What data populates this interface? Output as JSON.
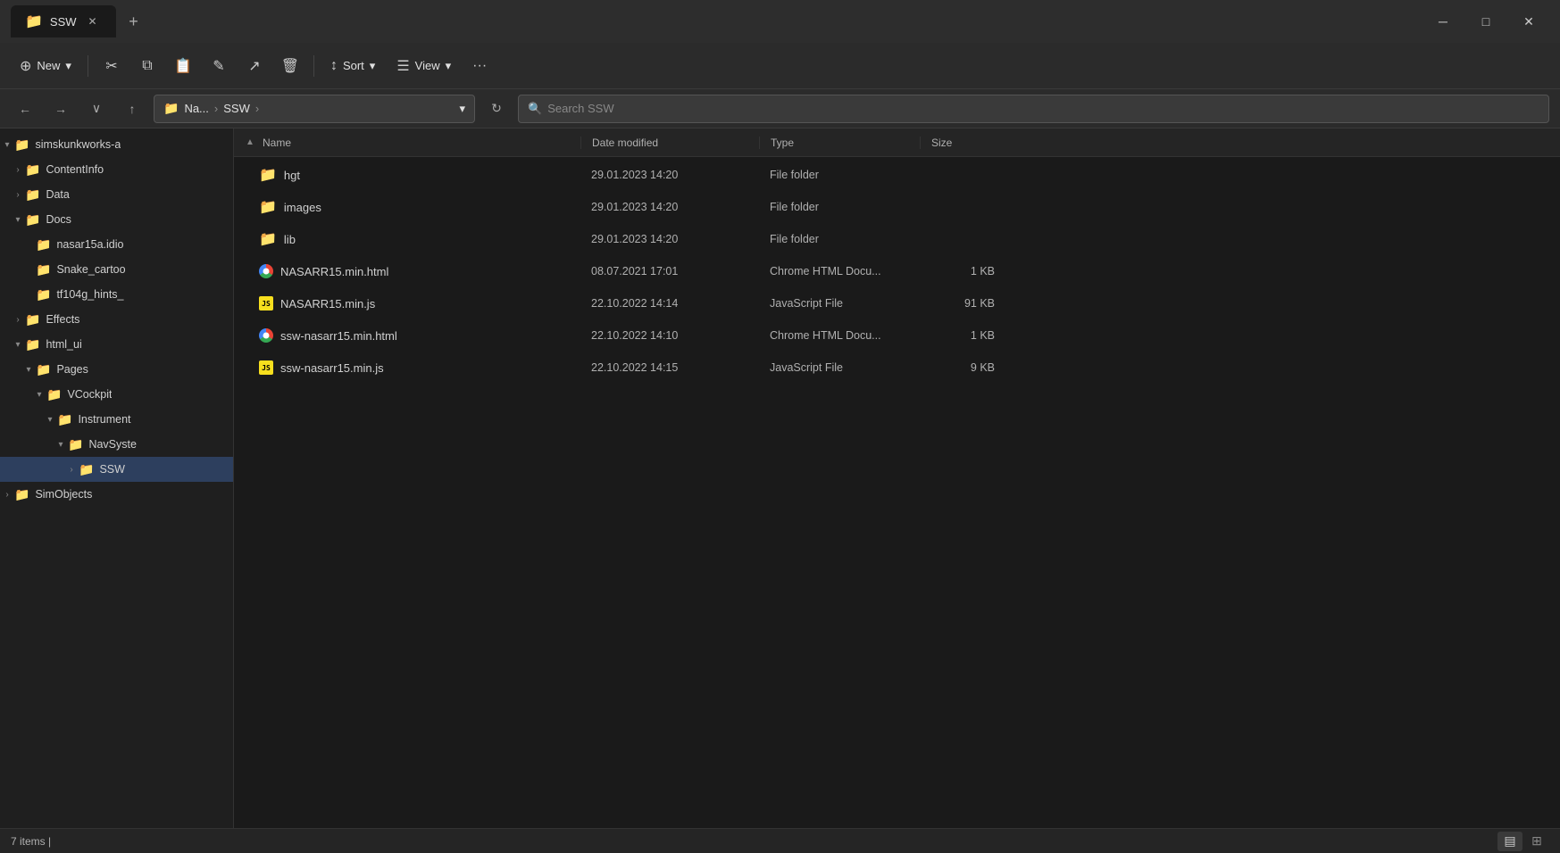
{
  "window": {
    "title": "SSW",
    "tab_label": "SSW",
    "new_tab_tooltip": "New tab"
  },
  "toolbar": {
    "new_label": "New",
    "new_arrow": "▾",
    "cut_icon": "✂",
    "copy_icon": "⧉",
    "paste_icon": "📋",
    "rename_icon": "✎",
    "share_icon": "↗",
    "delete_icon": "🗑",
    "sort_label": "Sort",
    "sort_icon": "↑↓",
    "sort_arrow": "▾",
    "view_label": "View",
    "view_icon": "☰",
    "view_arrow": "▾",
    "more_icon": "···"
  },
  "address": {
    "back_arrow": "←",
    "forward_arrow": "→",
    "recent_arrow": "∨",
    "up_arrow": "↑",
    "path_parts": [
      "Na...",
      "SSW"
    ],
    "search_placeholder": "Search SSW",
    "refresh_icon": "↻"
  },
  "sidebar": {
    "items": [
      {
        "id": "simskunkworks",
        "label": "simskunkworks-a",
        "indent": 0,
        "expanded": true,
        "selected": false
      },
      {
        "id": "contentinfo",
        "label": "ContentInfo",
        "indent": 1,
        "expanded": false,
        "selected": false
      },
      {
        "id": "data",
        "label": "Data",
        "indent": 1,
        "expanded": false,
        "selected": false
      },
      {
        "id": "docs",
        "label": "Docs",
        "indent": 1,
        "expanded": true,
        "selected": false
      },
      {
        "id": "nasar15a",
        "label": "nasar15a.idio",
        "indent": 2,
        "expanded": false,
        "selected": false,
        "noChevron": true
      },
      {
        "id": "snake_cartoon",
        "label": "Snake_cartoo",
        "indent": 2,
        "expanded": false,
        "selected": false,
        "noChevron": true
      },
      {
        "id": "tf104g",
        "label": "tf104g_hints_",
        "indent": 2,
        "expanded": false,
        "selected": false,
        "noChevron": true
      },
      {
        "id": "effects",
        "label": "Effects",
        "indent": 1,
        "expanded": false,
        "selected": false
      },
      {
        "id": "html_ui",
        "label": "html_ui",
        "indent": 1,
        "expanded": true,
        "selected": false
      },
      {
        "id": "pages",
        "label": "Pages",
        "indent": 2,
        "expanded": true,
        "selected": false
      },
      {
        "id": "vcockpit",
        "label": "VCockpit",
        "indent": 3,
        "expanded": true,
        "selected": false
      },
      {
        "id": "instrument",
        "label": "Instrument",
        "indent": 4,
        "expanded": true,
        "selected": false
      },
      {
        "id": "navsyste",
        "label": "NavSyste",
        "indent": 5,
        "expanded": true,
        "selected": false
      },
      {
        "id": "ssw",
        "label": "SSW",
        "indent": 6,
        "expanded": false,
        "selected": true
      },
      {
        "id": "simobjects",
        "label": "SimObjects",
        "indent": 0,
        "expanded": false,
        "selected": false
      }
    ]
  },
  "columns": {
    "name": "Name",
    "date_modified": "Date modified",
    "type": "Type",
    "size": "Size"
  },
  "files": [
    {
      "id": "hgt",
      "name": "hgt",
      "type_icon": "folder",
      "date": "29.01.2023 14:20",
      "file_type": "File folder",
      "size": ""
    },
    {
      "id": "images",
      "name": "images",
      "type_icon": "folder",
      "date": "29.01.2023 14:20",
      "file_type": "File folder",
      "size": ""
    },
    {
      "id": "lib",
      "name": "lib",
      "type_icon": "folder",
      "date": "29.01.2023 14:20",
      "file_type": "File folder",
      "size": ""
    },
    {
      "id": "nasarr15-html",
      "name": "NASARR15.min.html",
      "type_icon": "chrome",
      "date": "08.07.2021 17:01",
      "file_type": "Chrome HTML Docu...",
      "size": "1 KB"
    },
    {
      "id": "nasarr15-js",
      "name": "NASARR15.min.js",
      "type_icon": "js",
      "date": "22.10.2022 14:14",
      "file_type": "JavaScript File",
      "size": "91 KB"
    },
    {
      "id": "ssw-nasarr15-html",
      "name": "ssw-nasarr15.min.html",
      "type_icon": "chrome",
      "date": "22.10.2022 14:10",
      "file_type": "Chrome HTML Docu...",
      "size": "1 KB"
    },
    {
      "id": "ssw-nasarr15-js",
      "name": "ssw-nasarr15.min.js",
      "type_icon": "js",
      "date": "22.10.2022 14:15",
      "file_type": "JavaScript File",
      "size": "9 KB"
    }
  ],
  "status": {
    "item_count": "7 items",
    "cursor": "|"
  }
}
